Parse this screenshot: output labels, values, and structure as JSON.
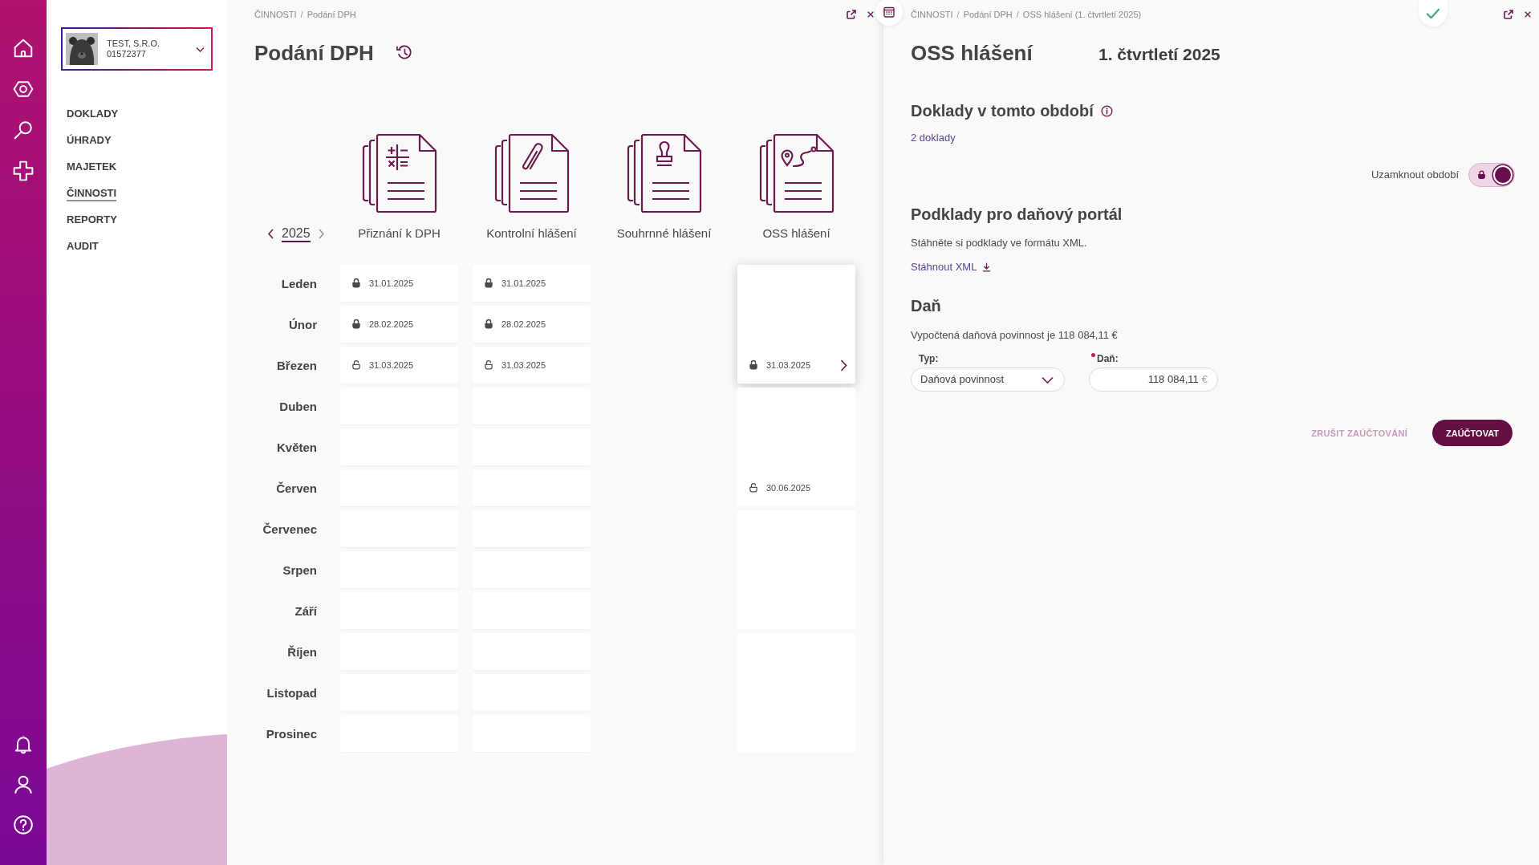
{
  "sidebar": {
    "company": {
      "name": "TEST, S.R.O.",
      "id": "01572377"
    },
    "nav": [
      {
        "label": "DOKLADY",
        "selected": false
      },
      {
        "label": "ÚHRADY",
        "selected": false
      },
      {
        "label": "MAJETEK",
        "selected": false
      },
      {
        "label": "ČINNOSTI",
        "selected": true
      },
      {
        "label": "REPORTY",
        "selected": false
      },
      {
        "label": "AUDIT",
        "selected": false
      }
    ]
  },
  "overview": {
    "breadcrumb": [
      {
        "kind": "link",
        "text": "ČINNOSTI"
      },
      {
        "kind": "separator",
        "text": "/"
      },
      {
        "kind": "current",
        "text": "Podání DPH"
      }
    ],
    "title": "Podání DPH",
    "year": "2025",
    "months": [
      "Leden",
      "Únor",
      "Březen",
      "Duben",
      "Květen",
      "Červen",
      "Červenec",
      "Srpen",
      "Září",
      "Říjen",
      "Listopad",
      "Prosinec"
    ],
    "reports": [
      {
        "label": "Přiznání k DPH",
        "kind": "monthly",
        "entries": [
          {
            "date": "31.01.2025",
            "locked": true
          },
          {
            "date": "28.02.2025",
            "locked": true
          },
          {
            "date": "31.03.2025",
            "locked": false
          }
        ]
      },
      {
        "label": "Kontrolní hlášení",
        "kind": "monthly",
        "entries": [
          {
            "date": "31.01.2025",
            "locked": true
          },
          {
            "date": "28.02.2025",
            "locked": true
          },
          {
            "date": "31.03.2025",
            "locked": false
          }
        ]
      },
      {
        "label": "Souhrnné hlášení",
        "kind": "none"
      },
      {
        "label": "OSS hlášení",
        "kind": "quarterly",
        "entries": [
          {
            "date": "31.03.2025",
            "locked": true,
            "selected": true
          },
          {
            "date": "30.06.2025",
            "locked": false,
            "selected": false
          },
          {
            "selected": false
          },
          {
            "selected": false
          }
        ]
      }
    ]
  },
  "detail": {
    "breadcrumb": [
      {
        "kind": "link",
        "text": "ČINNOSTI"
      },
      {
        "kind": "separator",
        "text": "/"
      },
      {
        "kind": "link",
        "text": "Podání DPH"
      },
      {
        "kind": "separator",
        "text": "/"
      },
      {
        "kind": "current",
        "text": "OSS hlášení (1. čtvrtletí 2025)"
      }
    ],
    "title": "OSS hlášení",
    "period": "1. čtvrtletí 2025",
    "documents": {
      "heading": "Doklady v tomto období",
      "link": "2 doklady"
    },
    "lock_toggle": {
      "label": "Uzamknout období",
      "on": true
    },
    "portal": {
      "heading": "Podklady pro daňový portál",
      "text": "Stáhněte si podklady ve formátu XML.",
      "link": "Stáhnout XML"
    },
    "tax": {
      "heading": "Daň",
      "summary": "Vypočtená daňová povinnost je 118 084,11 €",
      "type_field": {
        "label": "Typ:",
        "value": "Daňová povinnost"
      },
      "amount_field": {
        "label": "Daň:",
        "required": true,
        "value": "118 084,11",
        "suffix": "€"
      }
    },
    "actions": [
      {
        "label": "ZRUŠIT ZAÚČTOVÁNÍ",
        "kind": "text"
      },
      {
        "label": "ZAÚČTOVAT",
        "kind": "primary"
      }
    ]
  }
}
